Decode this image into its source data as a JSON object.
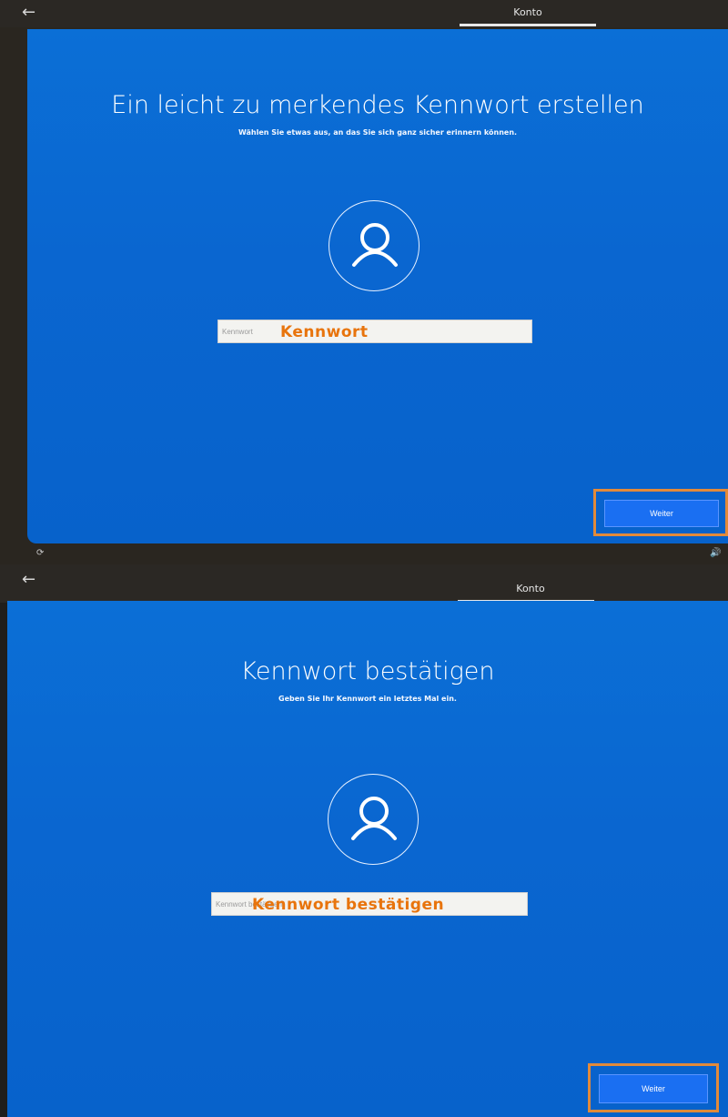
{
  "screens": [
    {
      "top_bar": {
        "back_icon": "←",
        "tab_label": "Konto"
      },
      "title": "Ein leicht zu merkendes Kennwort erstellen",
      "subtitle": "Wählen Sie etwas aus, an das Sie sich ganz sicher erinnern können.",
      "avatar_icon": "user-icon",
      "field": {
        "placeholder": "Kennwort",
        "annotation": "Kennwort",
        "value": ""
      },
      "next_button_label": "Weiter",
      "bottom_left_icon": "ease-of-access-icon",
      "bottom_right_icon": "volume-icon"
    },
    {
      "top_bar": {
        "back_icon": "←",
        "tab_label": "Konto"
      },
      "title": "Kennwort bestätigen",
      "subtitle": "Geben Sie Ihr Kennwort ein letztes Mal ein.",
      "avatar_icon": "user-icon",
      "field": {
        "placeholder": "Kennwort bestätigen",
        "annotation": "Kennwort bestätigen",
        "value": ""
      },
      "next_button_label": "Weiter"
    }
  ],
  "colors": {
    "panel_blue": "#0a66d0",
    "highlight_orange": "#e8740c",
    "button_blue": "#1a6ff2"
  }
}
